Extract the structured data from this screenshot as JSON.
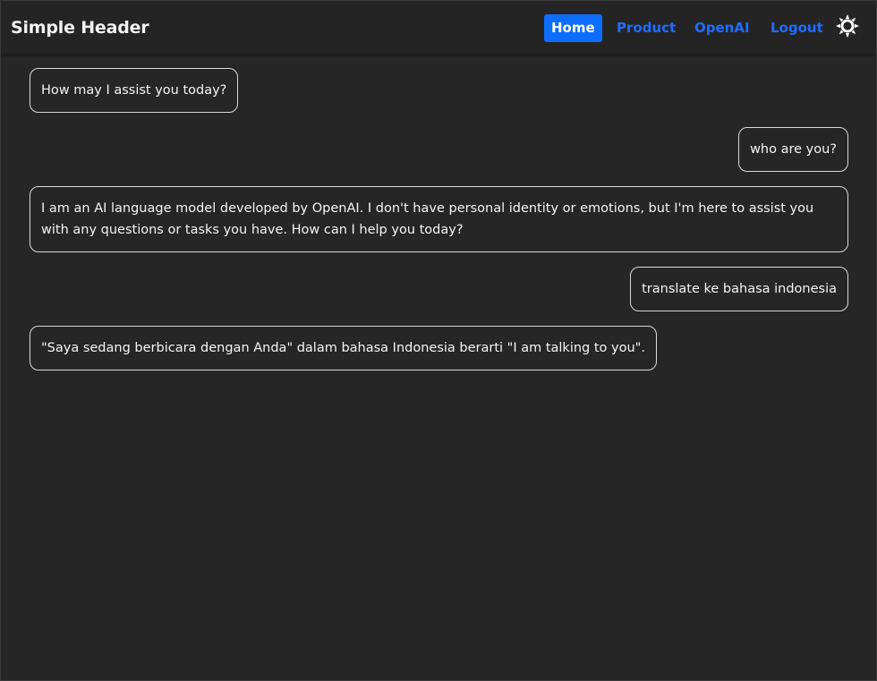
{
  "header": {
    "brand": "Simple Header",
    "nav": [
      {
        "label": "Home",
        "active": true
      },
      {
        "label": "Product",
        "active": false
      },
      {
        "label": "OpenAI",
        "active": false
      },
      {
        "label": "Logout",
        "active": false
      }
    ],
    "theme_toggle_icon": "sun-icon"
  },
  "chat": {
    "messages": [
      {
        "role": "assistant",
        "text": "How may I assist you today?"
      },
      {
        "role": "user",
        "text": "who are you?"
      },
      {
        "role": "assistant",
        "text": "I am an AI language model developed by OpenAI. I don't have personal identity or emotions, but I'm here to assist you with any questions or tasks you have. How can I help you today?"
      },
      {
        "role": "user",
        "text": "translate ke bahasa indonesia"
      },
      {
        "role": "assistant",
        "text": "\"Saya sedang berbicara dengan Anda\" dalam bahasa Indonesia berarti \"I am talking to you\"."
      }
    ]
  },
  "colors": {
    "background": "#262626",
    "header_background": "#242424",
    "accent": "#0d6efd",
    "link": "#1f6dff",
    "text": "#f4f4f4",
    "bubble_border": "#d9d9d9"
  }
}
